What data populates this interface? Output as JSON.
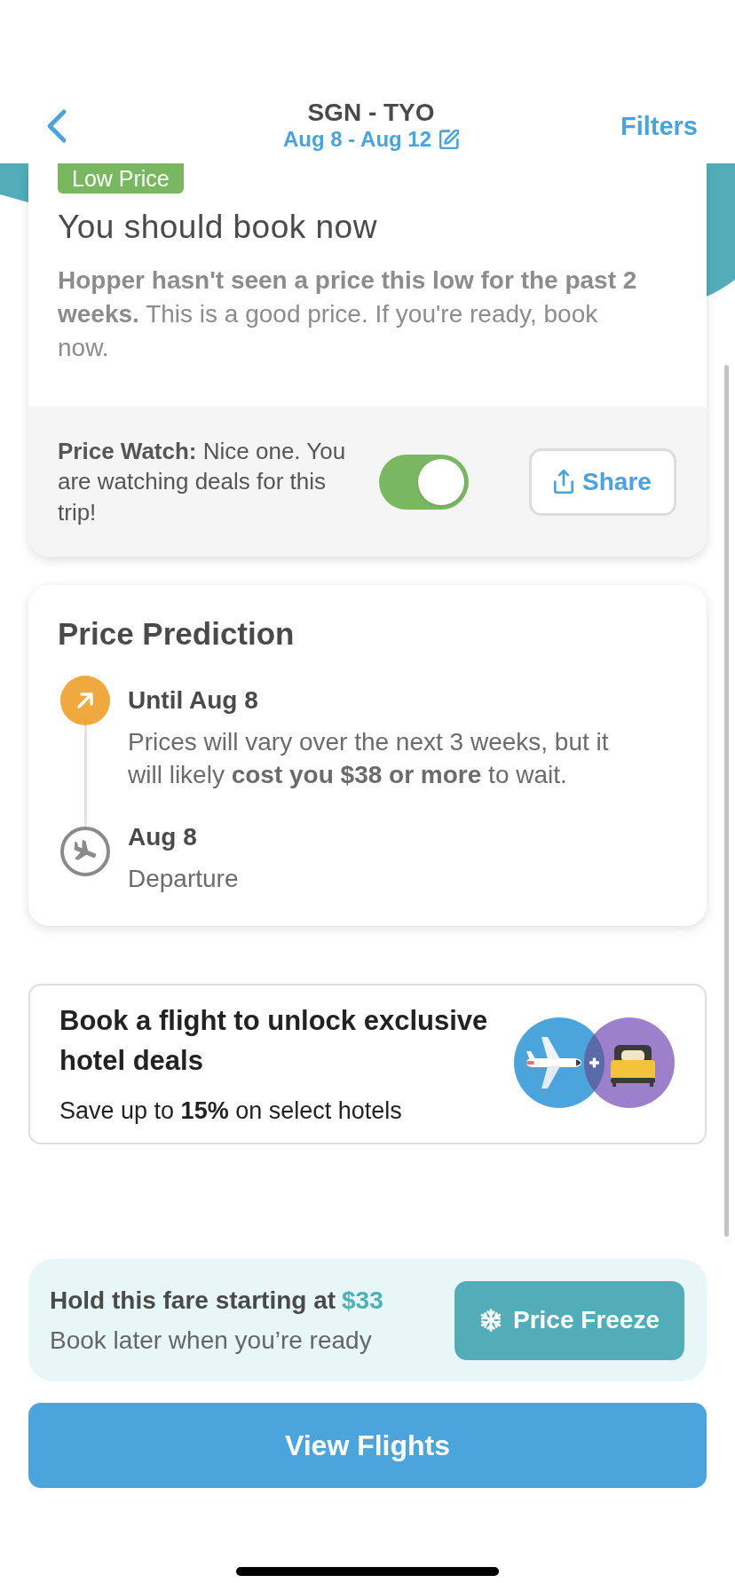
{
  "header": {
    "title": "SGN - TYO",
    "dates": "Aug 8 - Aug 12",
    "filters": "Filters"
  },
  "recommendation": {
    "badge": "Low Price",
    "title": "You should book now",
    "message": "**Hopper hasn't seen a price this low for the past 2 weeks.** This is a good price. If you're ready, book now."
  },
  "price_watch": {
    "text": "**Price Watch:** Nice one. You are watching deals for this trip!",
    "on": true,
    "share": "Share"
  },
  "prediction": {
    "title": "Price Prediction",
    "steps": [
      {
        "kind": "trend",
        "title": "Until Aug 8",
        "text": "Prices will vary over the next 3 weeks, but it will likely **cost you $38 or more** to wait."
      },
      {
        "kind": "departure",
        "title": "Aug 8",
        "text": "Departure"
      }
    ]
  },
  "hotel_promo": {
    "title": "Book a flight to unlock exclusive hotel deals",
    "text": "Save up to **15%** on select hotels"
  },
  "price_freeze": {
    "label": "Hold this fare starting at",
    "price": "$33",
    "subtext": "Book later when you’re ready",
    "button": "Price Freeze"
  },
  "primary_button": "View Flights"
}
